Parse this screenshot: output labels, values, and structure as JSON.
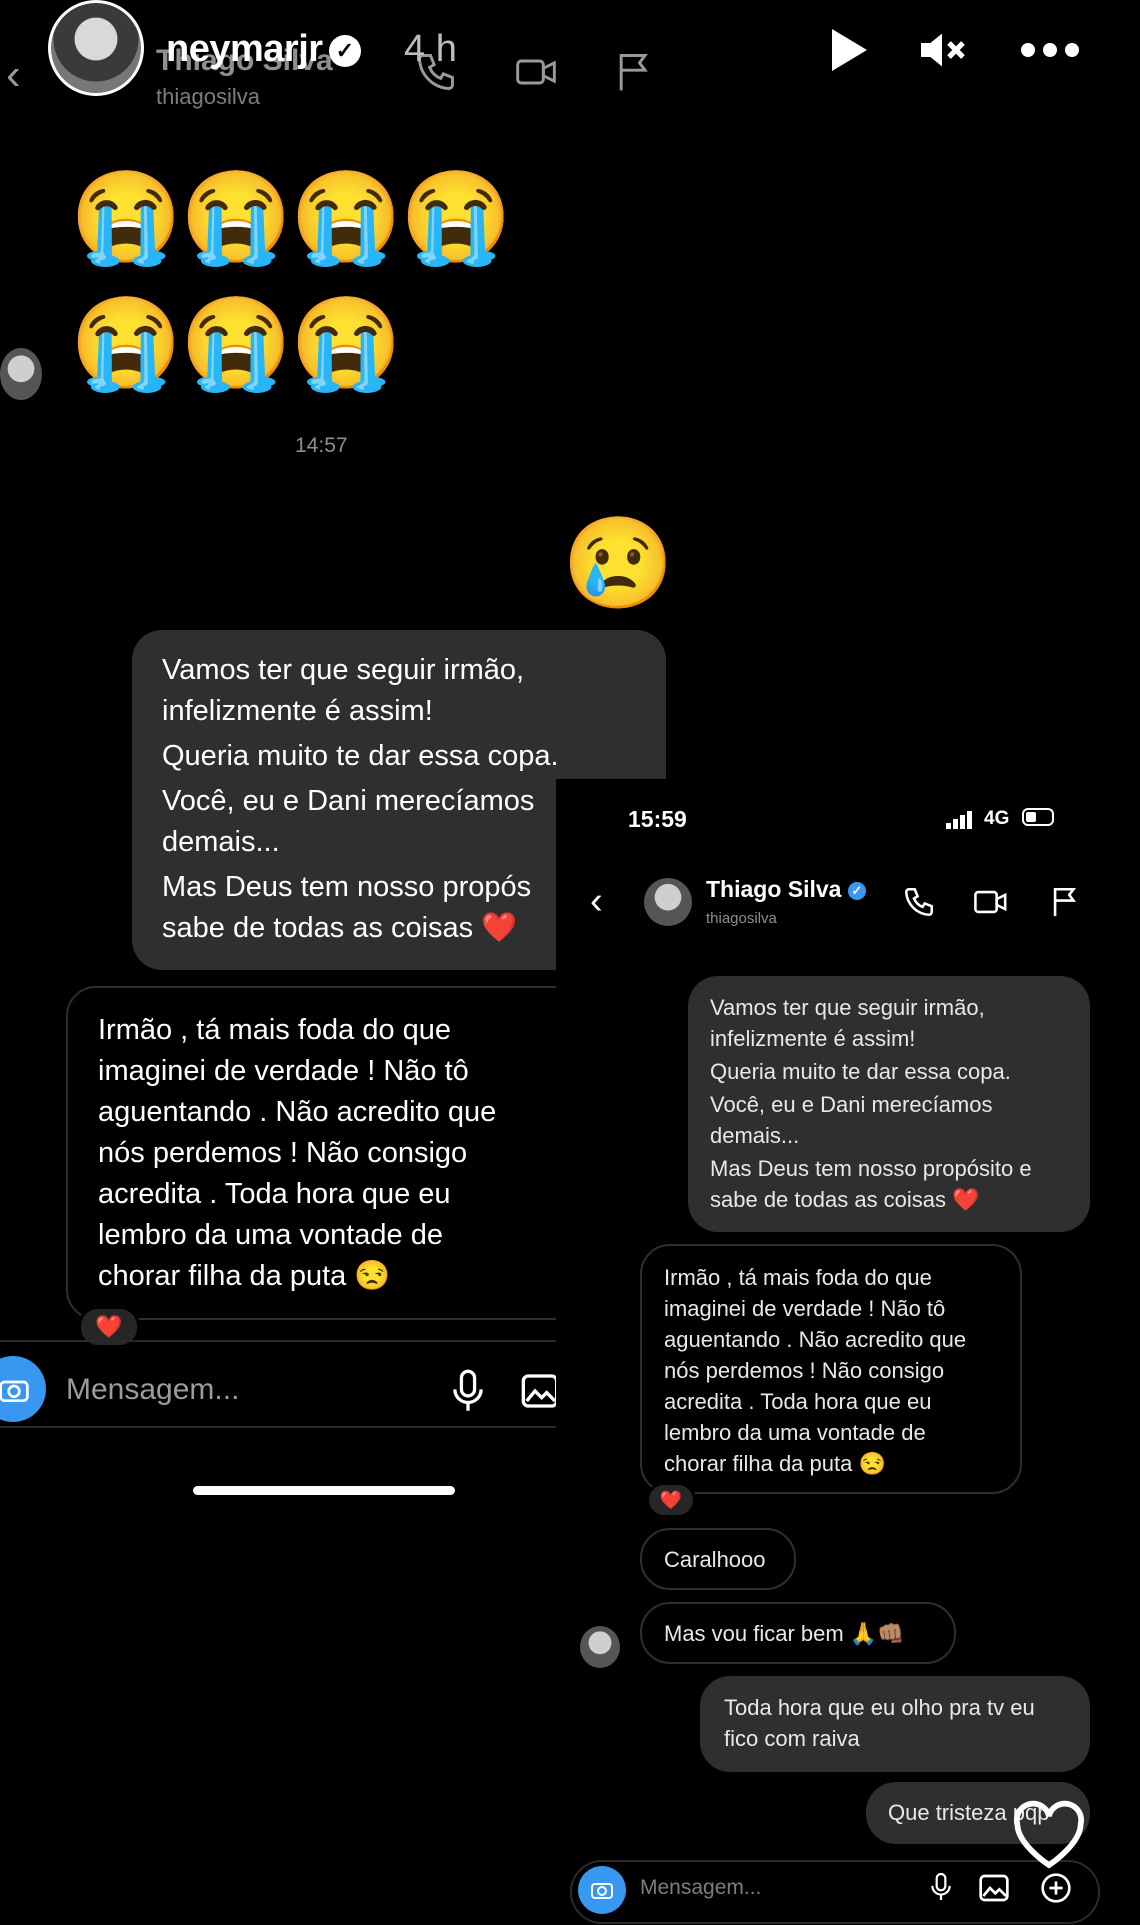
{
  "story": {
    "username": "neymarjr",
    "time": "4 h",
    "background_chat_name": "Thiago Silva",
    "background_chat_handle": "thiagosilva"
  },
  "left_chat": {
    "timestamp": "14:57",
    "emojis_row1": [
      "😭",
      "😭",
      "😭",
      "😭"
    ],
    "emojis_row2": [
      "😭",
      "😭",
      "😭"
    ],
    "sent_emoji": "😢",
    "sent_lines": [
      "Vamos ter que seguir irmão,",
      "infelizmente é assim!",
      "Queria muito te dar essa copa.",
      "Você, eu e Dani merecíamos",
      "demais...",
      "Mas Deus tem nosso propós",
      "sabe de todas as coisas ❤️"
    ],
    "received_lines": [
      "Irmão , tá mais foda do que",
      "imaginei de verdade ! Não tô",
      "aguentando . Não acredito que",
      "nós perdemos ! Não consigo",
      "acredita . Toda hora que eu",
      "lembro da uma vontade de",
      "chorar filha da puta 😒"
    ],
    "reaction": "❤️",
    "compose_placeholder": "Mensagem..."
  },
  "right_chat": {
    "status_time": "15:59",
    "network": "4G",
    "contact_name": "Thiago Silva",
    "contact_handle": "thiagosilva",
    "sent_lines": [
      "Vamos ter que seguir irmão,",
      "infelizmente é assim!",
      "Queria muito te dar essa copa.",
      "Você, eu e Dani merecíamos",
      "demais...",
      "Mas Deus tem nosso propósito e",
      "sabe de todas as coisas ❤️"
    ],
    "received_lines": [
      "Irmão , tá mais foda do que",
      "imaginei de verdade ! Não tô",
      "aguentando . Não acredito que",
      "nós perdemos ! Não consigo",
      "acredita . Toda hora que eu",
      "lembro da uma vontade de",
      "chorar filha da puta 😒"
    ],
    "reaction": "❤️",
    "received_2": "Caralhooo",
    "received_3": "Mas vou ficar bem 🙏👊🏽",
    "sent_2_lines": [
      "Toda hora que eu olho pra tv eu",
      "fico com raiva"
    ],
    "sent_3": "Que tristeza pqp",
    "compose_placeholder": "Mensagem..."
  },
  "colors": {
    "background": "#000000",
    "bubble_sent": "#2f2f2f",
    "camera_button": "#3897f0",
    "heart": "#e4312f"
  }
}
